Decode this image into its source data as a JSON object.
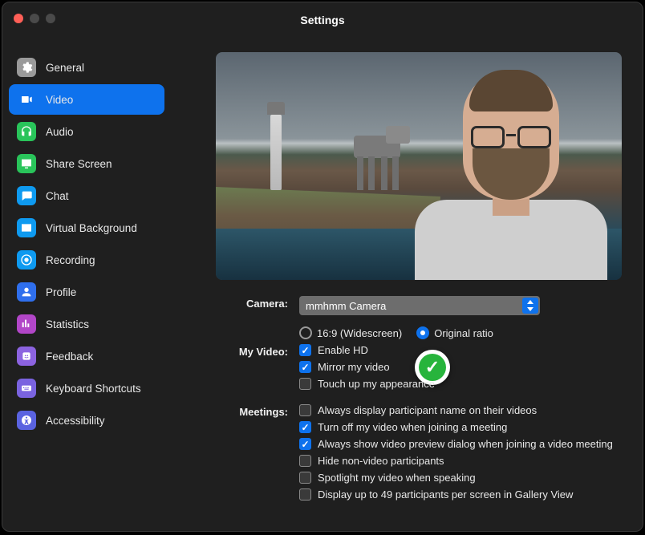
{
  "window": {
    "title": "Settings"
  },
  "sidebar": {
    "items": [
      {
        "label": "General",
        "icon": "gear-icon",
        "color": "#9a9a9a"
      },
      {
        "label": "Video",
        "icon": "video-icon",
        "color": "#ffffff",
        "active": true
      },
      {
        "label": "Audio",
        "icon": "headphones-icon",
        "color": "#29c45a"
      },
      {
        "label": "Share Screen",
        "icon": "share-screen-icon",
        "color": "#29c45a"
      },
      {
        "label": "Chat",
        "icon": "chat-icon",
        "color": "#0e9af0"
      },
      {
        "label": "Virtual Background",
        "icon": "virtual-bg-icon",
        "color": "#0e9af0"
      },
      {
        "label": "Recording",
        "icon": "recording-icon",
        "color": "#0e9af0"
      },
      {
        "label": "Profile",
        "icon": "profile-icon",
        "color": "#2f6fed"
      },
      {
        "label": "Statistics",
        "icon": "statistics-icon",
        "color": "#b246c8"
      },
      {
        "label": "Feedback",
        "icon": "feedback-icon",
        "color": "#8c63e0"
      },
      {
        "label": "Keyboard Shortcuts",
        "icon": "keyboard-icon",
        "color": "#7a63e0"
      },
      {
        "label": "Accessibility",
        "icon": "accessibility-icon",
        "color": "#5a63e0"
      }
    ]
  },
  "camera": {
    "label": "Camera:",
    "selected": "mmhmm Camera",
    "ratio": {
      "widescreen": {
        "label": "16:9 (Widescreen)",
        "checked": false
      },
      "original": {
        "label": "Original ratio",
        "checked": true
      }
    }
  },
  "my_video": {
    "label": "My Video:",
    "options": [
      {
        "label": "Enable HD",
        "checked": true
      },
      {
        "label": "Mirror my video",
        "checked": true,
        "highlighted": true
      },
      {
        "label": "Touch up my appearance",
        "checked": false
      }
    ]
  },
  "meetings": {
    "label": "Meetings:",
    "options": [
      {
        "label": "Always display participant name on their videos",
        "checked": false
      },
      {
        "label": "Turn off my video when joining a meeting",
        "checked": true
      },
      {
        "label": "Always show video preview dialog when joining a video meeting",
        "checked": true
      },
      {
        "label": "Hide non-video participants",
        "checked": false
      },
      {
        "label": "Spotlight my video when speaking",
        "checked": false
      },
      {
        "label": "Display up to 49 participants per screen in Gallery View",
        "checked": false
      }
    ]
  }
}
